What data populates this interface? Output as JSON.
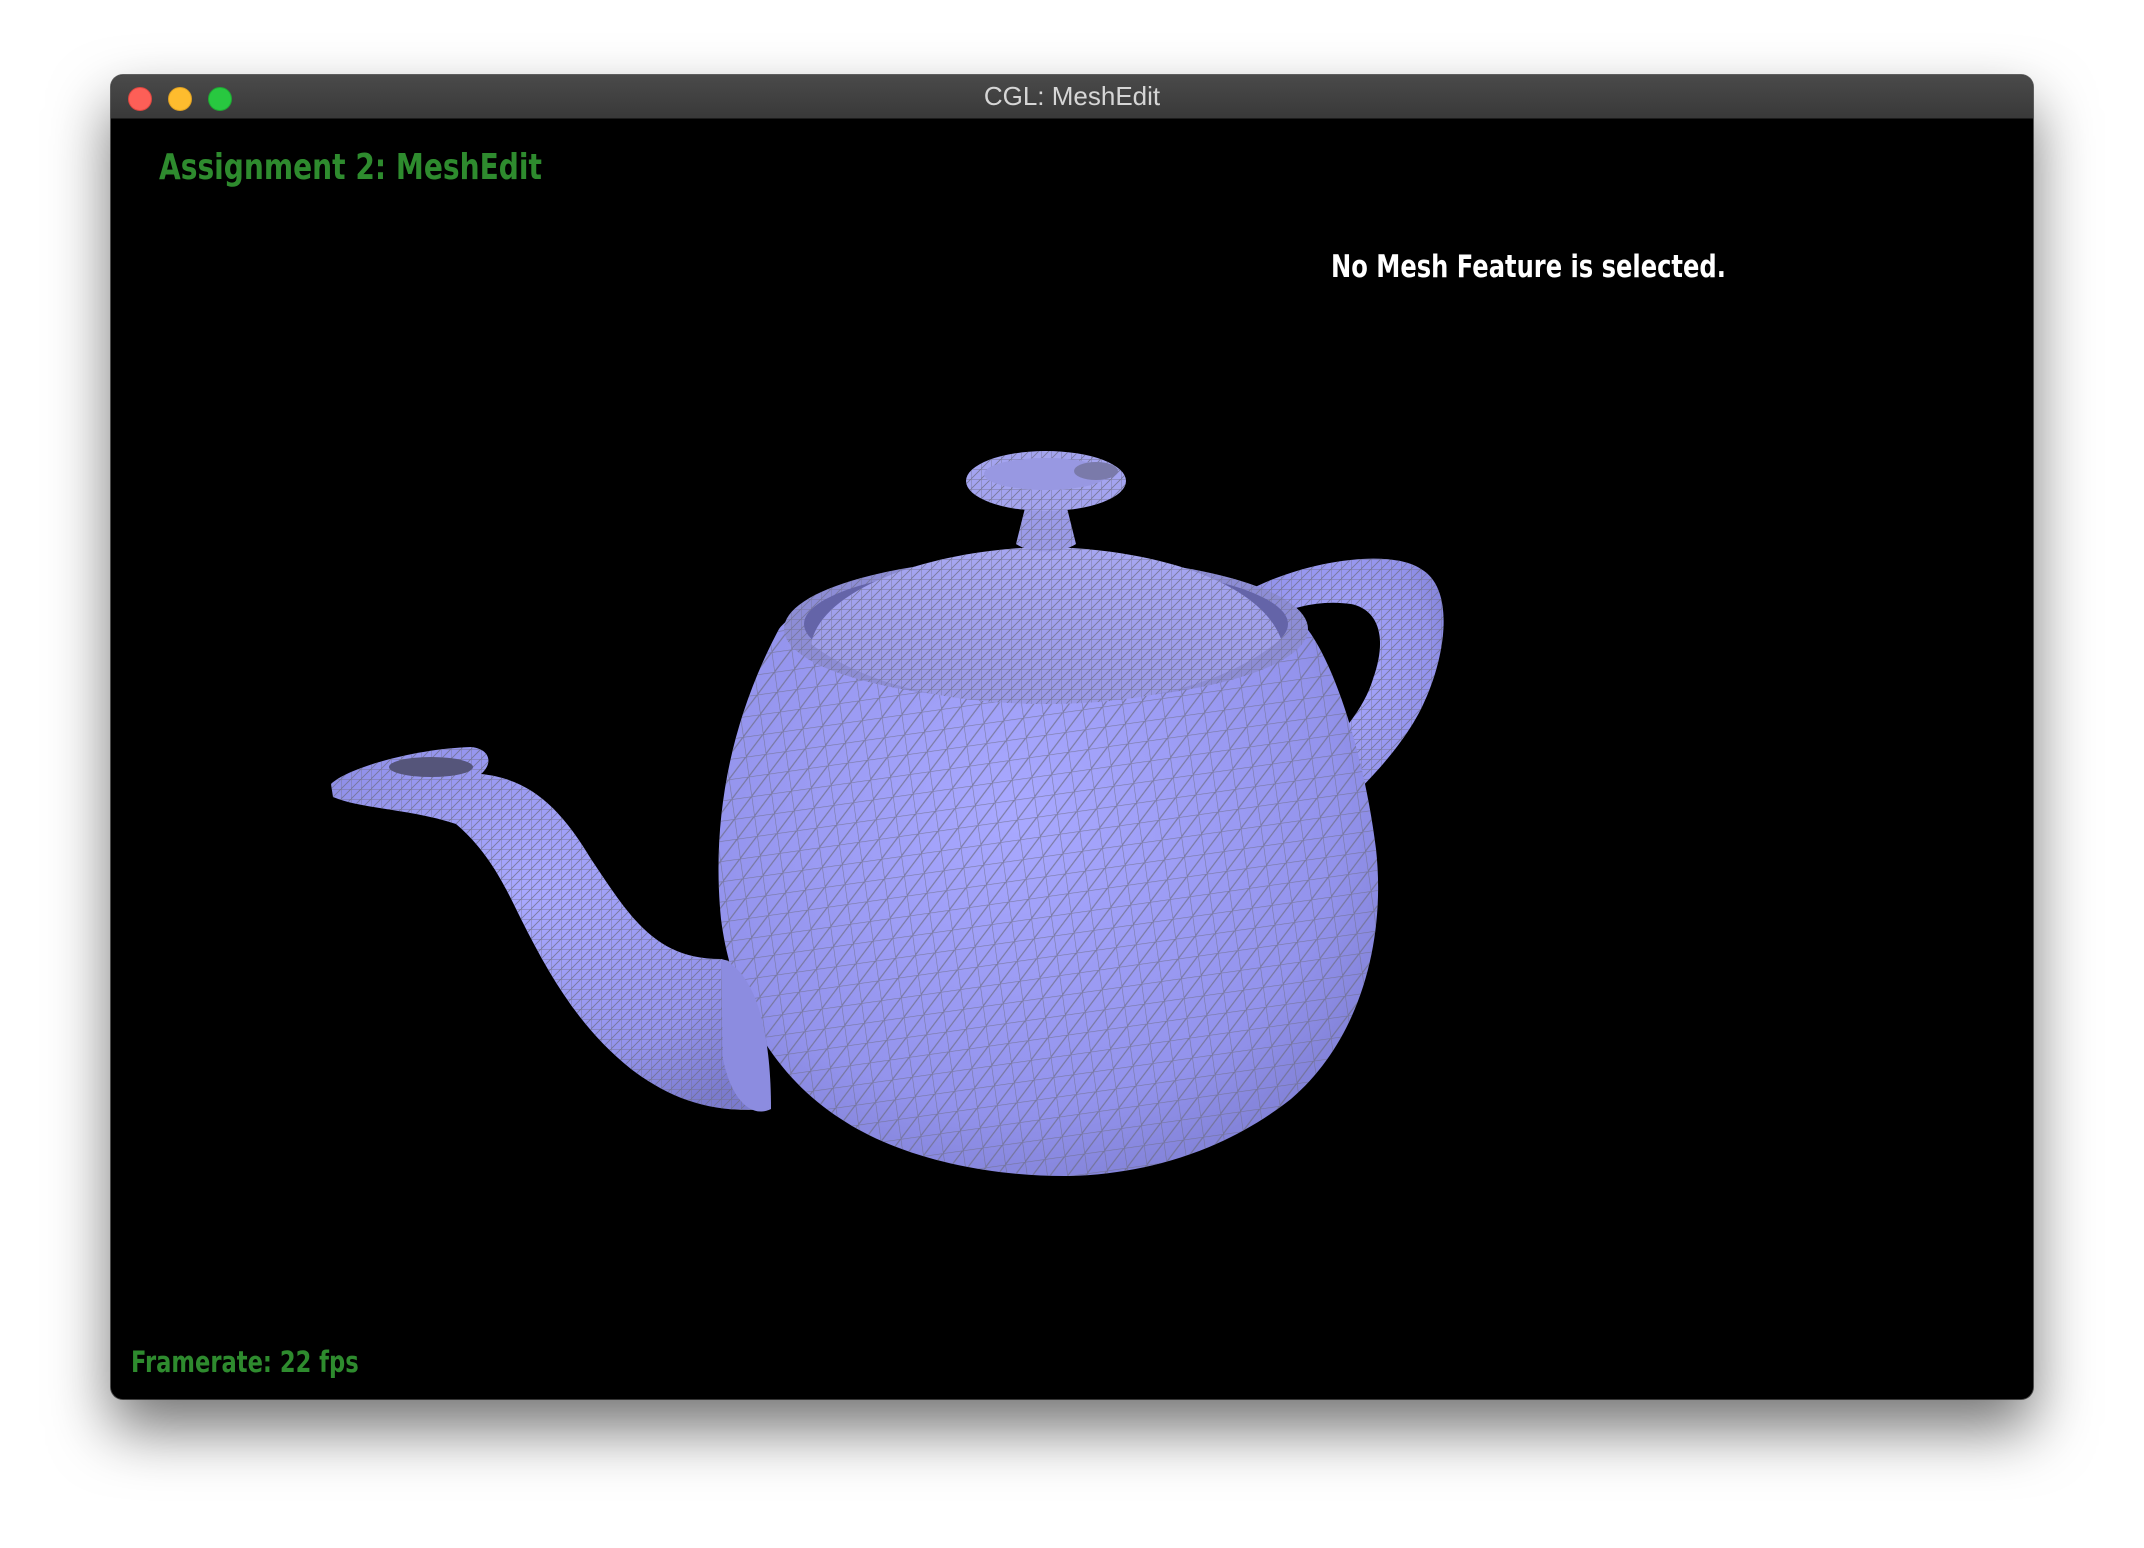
{
  "window": {
    "title": "CGL: MeshEdit"
  },
  "viewport": {
    "heading": "Assignment 2: MeshEdit",
    "selection_status": "No Mesh Feature is selected.",
    "framerate_label": "Framerate: 22 fps",
    "background_color": "#000000",
    "mesh_color": "#9a9af5",
    "wireframe_color": "#7a7a8a",
    "heading_color": "#2e8b2e"
  },
  "model": {
    "name_icon": "teapot-mesh"
  }
}
